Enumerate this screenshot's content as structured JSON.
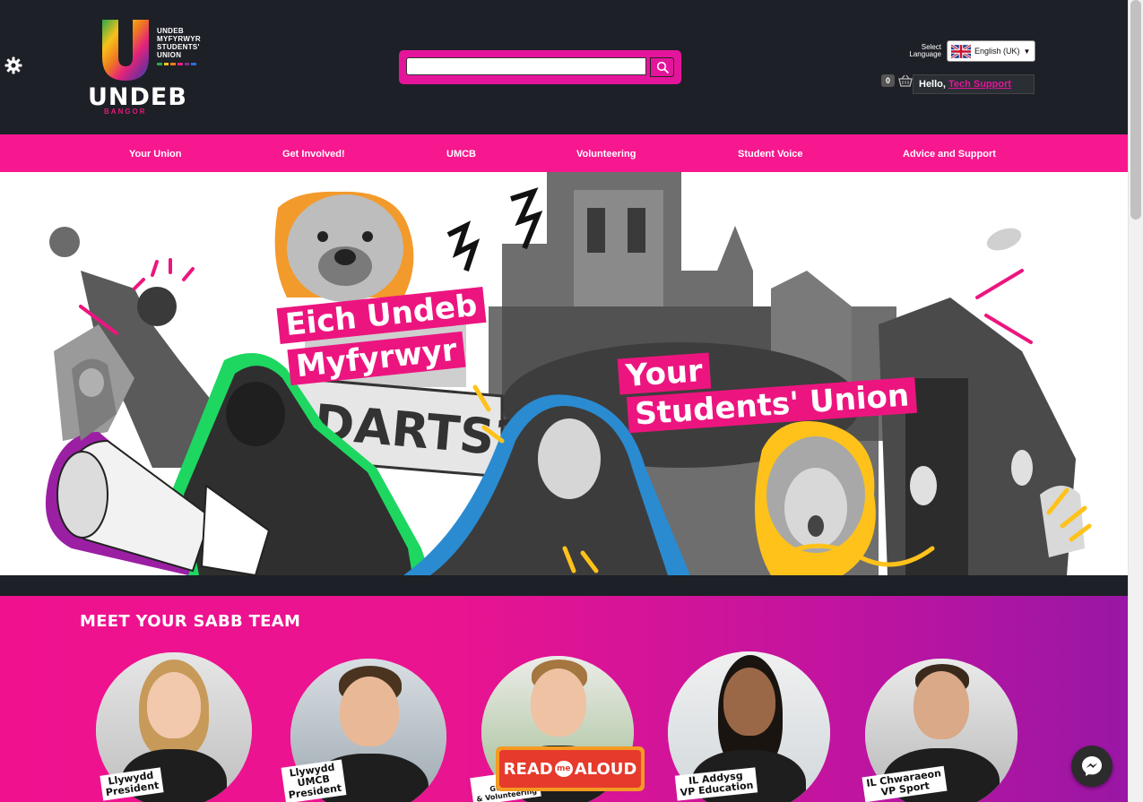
{
  "header": {
    "logo": {
      "side_lines": [
        "UNDEB",
        "MYFYRWYR",
        "STUDENTS'",
        "UNION"
      ],
      "word": "UNDEB",
      "sub": "BANGOR"
    },
    "search": {
      "placeholder": "",
      "value": ""
    },
    "language": {
      "label_line1": "Select",
      "label_line2": "Language",
      "selected": "English (UK)"
    },
    "cart": {
      "count": "0"
    },
    "greeting": {
      "hello": "Hello,",
      "name": "Tech Support"
    }
  },
  "nav": {
    "items": [
      {
        "label": "Your Union"
      },
      {
        "label": "Get Involved!"
      },
      {
        "label": "UMCB"
      },
      {
        "label": "Volunteering"
      },
      {
        "label": "Student Voice"
      },
      {
        "label": "Advice and Support"
      }
    ]
  },
  "hero": {
    "welsh_line1": "Eich Undeb",
    "welsh_line2": "Myfyrwyr",
    "english_line1": "Your",
    "english_line2": "Students' Union"
  },
  "sabb": {
    "title": "MEET YOUR SABB TEAM",
    "members": [
      {
        "role_line1": "Llywydd",
        "role_line2": "President",
        "role_line3": ""
      },
      {
        "role_line1": "Llywydd",
        "role_line2": "UMCB",
        "role_line3": "President"
      },
      {
        "role_line1": "IL C",
        "role_line2": "Gwirfod",
        "role_line3": "& Volunteering"
      },
      {
        "role_line1": "IL Addysg",
        "role_line2": "VP Education",
        "role_line3": ""
      },
      {
        "role_line1": "IL Chwaraeon",
        "role_line2": "VP Sport",
        "role_line3": ""
      }
    ]
  },
  "widgets": {
    "readaloud_left": "READ",
    "readaloud_me": "me",
    "readaloud_right": "ALOUD"
  },
  "colors": {
    "header_bg": "#1d2026",
    "accent_pink": "#f7178e",
    "search_pink": "#e4159a",
    "link_pink": "#e4159a"
  },
  "icons": {
    "settings": "gear-icon",
    "search": "search-icon",
    "basket": "basket-icon",
    "flag": "uk-flag-icon",
    "messenger": "messenger-icon"
  }
}
